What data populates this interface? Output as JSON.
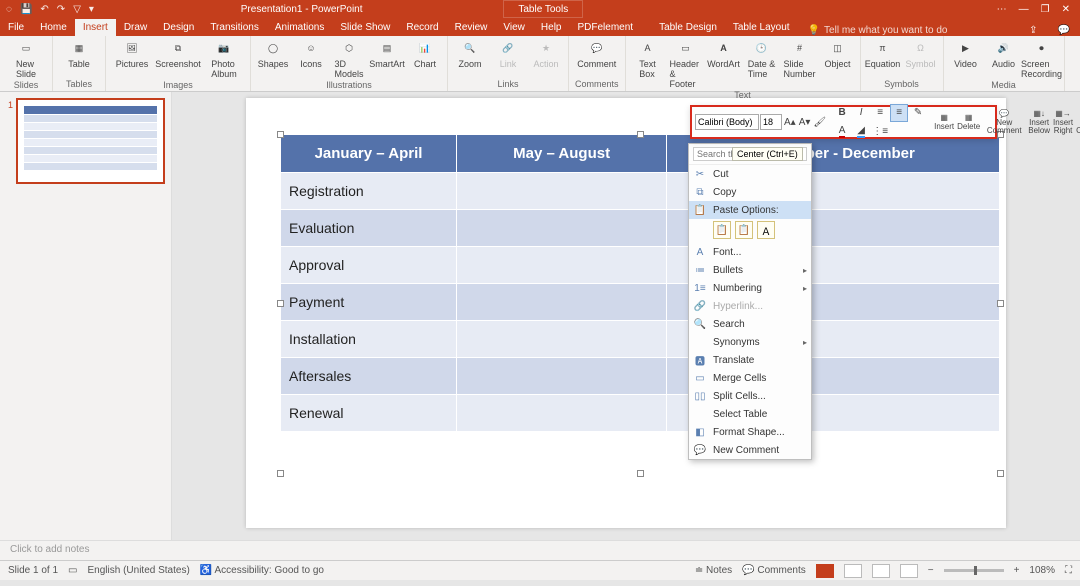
{
  "titlebar": {
    "doc_title": "Presentation1 - PowerPoint",
    "table_tools": "Table Tools"
  },
  "win": {
    "min": "—",
    "restore": "❐",
    "close": "✕",
    "ribbonopts": "⋯"
  },
  "qat": {
    "autosave": "",
    "save": "💾",
    "undo": "↶",
    "redo": "↷",
    "start": "▽",
    "more": "▾"
  },
  "tabs": {
    "file": "File",
    "home": "Home",
    "insert": "Insert",
    "draw": "Draw",
    "design": "Design",
    "transitions": "Transitions",
    "animations": "Animations",
    "slideshow": "Slide Show",
    "record": "Record",
    "review": "Review",
    "view": "View",
    "help": "Help",
    "pdfelement": "PDFelement",
    "tabledesign": "Table Design",
    "tablelayout": "Table Layout",
    "tellme": "Tell me what you want to do"
  },
  "ribbon": {
    "newslide": "New\nSlide",
    "table": "Table",
    "pictures": "Pictures",
    "screenshot": "Screenshot",
    "photoalbum": "Photo\nAlbum",
    "shapes": "Shapes",
    "icons": "Icons",
    "models": "3D\nModels",
    "smartart": "SmartArt",
    "chart": "Chart",
    "zoom": "Zoom",
    "link": "Link",
    "action": "Action",
    "comment": "Comment",
    "textbox": "Text\nBox",
    "headerfooter": "Header\n& Footer",
    "wordart": "WordArt",
    "datetime": "Date &\nTime",
    "slidenumber": "Slide\nNumber",
    "object": "Object",
    "equation": "Equation",
    "symbol": "Symbol",
    "video": "Video",
    "audio": "Audio",
    "screenrec": "Screen\nRecording",
    "g_slides": "Slides",
    "g_tables": "Tables",
    "g_images": "Images",
    "g_illustrations": "Illustrations",
    "g_links": "Links",
    "g_comments": "Comments",
    "g_text": "Text",
    "g_symbols": "Symbols",
    "g_media": "Media"
  },
  "mini": {
    "font": "Calibri (Body)",
    "size": "18",
    "insert": "Insert",
    "delete": "Delete",
    "newcomment": "New\nComment",
    "insertbelow": "Insert\nBelow",
    "insertright": "Insert\nRight",
    "deletecolumns": "Delete\nColumns"
  },
  "tooltip": "Center (Ctrl+E)",
  "ctx": {
    "search_placeholder": "Search the menus",
    "cut": "Cut",
    "copy": "Copy",
    "paste_options": "Paste Options:",
    "font": "Font...",
    "bullets": "Bullets",
    "numbering": "Numbering",
    "hyperlink": "Hyperlink...",
    "search": "Search",
    "synonyms": "Synonyms",
    "translate": "Translate",
    "merge": "Merge Cells",
    "split": "Split Cells...",
    "selecttable": "Select Table",
    "formatshape": "Format Shape...",
    "newcomment": "New Comment"
  },
  "table": {
    "headers": [
      "January – April",
      "May – August",
      "September - December"
    ],
    "rows": [
      "Registration",
      "Evaluation",
      "Approval",
      "Payment",
      "Installation",
      "Aftersales",
      "Renewal"
    ]
  },
  "thumb_no": "1",
  "notes_placeholder": "Click to add notes",
  "status": {
    "slide": "Slide 1 of 1",
    "lang": "English (United States)",
    "access": "Accessibility: Good to go",
    "notes": "Notes",
    "comments": "Comments",
    "zoom": "108%"
  }
}
